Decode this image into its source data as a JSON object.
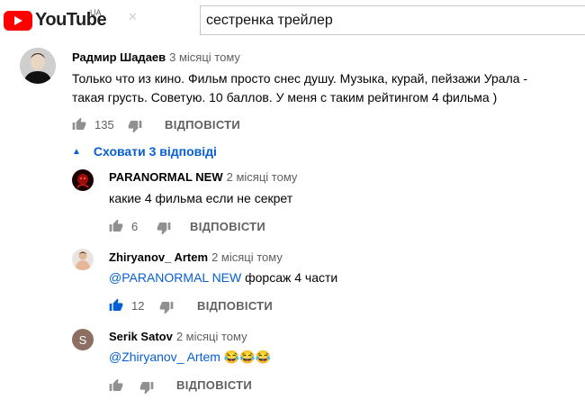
{
  "header": {
    "logo_text": "YouTube",
    "country_code": "UA",
    "search_value": "сестренка трейлер"
  },
  "comment": {
    "author": "Радмир Шадаев",
    "time": "3 місяці тому",
    "text_line1": "Только что из кино. Фильм просто снес душу. Музыка, курай, пейзажи Урала -",
    "text_line2": "такая грусть. Советую. 10 баллов. У меня с таким рейтингом 4 фильма )",
    "likes": "135",
    "reply_label": "ВІДПОВІСТИ"
  },
  "hide_replies_label": "Сховати 3 відповіді",
  "replies": [
    {
      "author": "PARANORMAL NEW",
      "time": "2 місяці тому",
      "text": "какие 4 фильма если не секрет",
      "likes": "6",
      "reply_label": "ВІДПОВІСТИ"
    },
    {
      "author": "Zhiryanov_ Artem",
      "time": "2 місяці тому",
      "mention": "@PARANORMAL NEW",
      "text": "форсаж 4 части",
      "likes": "12",
      "reply_label": "ВІДПОВІСТИ"
    },
    {
      "author": "Serik Satov",
      "time": "2 місяці тому",
      "avatar_letter": "S",
      "avatar_color": "#8d6e63",
      "mention": "@Zhiryanov_ Artem",
      "emoji": "😂😂😂",
      "reply_label": "ВІДПОВІСТИ"
    }
  ],
  "colors": {
    "link": "#065fd4",
    "secondary": "#606060",
    "brand": "#ff0000"
  }
}
